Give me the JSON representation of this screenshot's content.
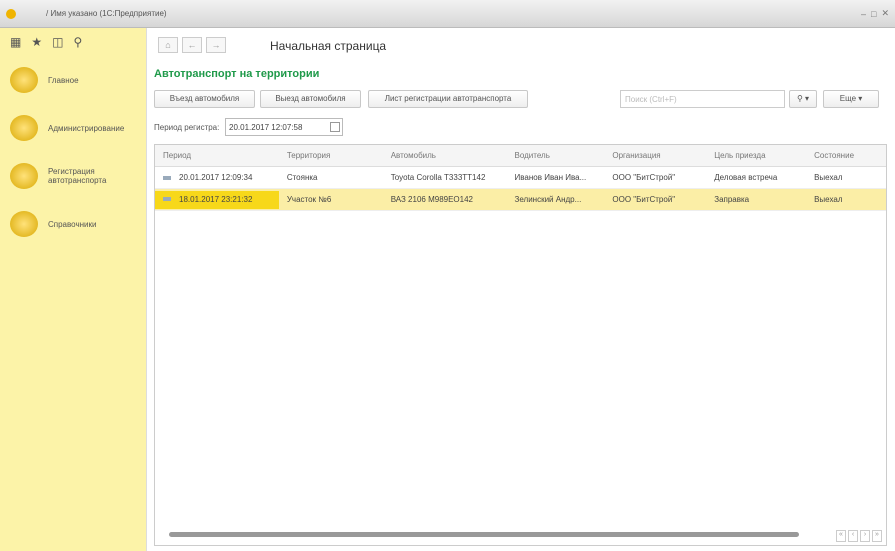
{
  "window": {
    "title": "/ Имя указано  (1С:Предприятие)"
  },
  "sidebar": {
    "items": [
      {
        "label": "Главное"
      },
      {
        "label": "Администрирование"
      },
      {
        "label": "Регистрация автотранспорта"
      },
      {
        "label": "Справочники"
      }
    ]
  },
  "page": {
    "title": "Начальная страница",
    "form_title": "Автотранспорт на территории"
  },
  "toolbar": {
    "btn1": "Въезд автомобиля",
    "btn2": "Выезд автомобиля",
    "btn3": "Лист регистрации автотранспорта",
    "search_placeholder": "Поиск (Ctrl+F)",
    "more": "Еще"
  },
  "filter": {
    "label": "Период регистра:",
    "value": "20.01.2017 12:07:58"
  },
  "table": {
    "headers": [
      "Период",
      "Территория",
      "Автомобиль",
      "Водитель",
      "Организация",
      "Цель приезда",
      "Состояние"
    ],
    "rows": [
      [
        "20.01.2017 12:09:34",
        "Стоянка",
        "Toyota Corolla Т333ТТ142",
        "Иванов Иван Ива...",
        "ООО \"БитСтрой\"",
        "Деловая встреча",
        "Выехал"
      ],
      [
        "18.01.2017 23:21:32",
        "Участок №6",
        "ВАЗ 2106 М989ЕО142",
        "Зелинский Андр...",
        "ООО \"БитСтрой\"",
        "Заправка",
        "Выехал"
      ]
    ]
  }
}
